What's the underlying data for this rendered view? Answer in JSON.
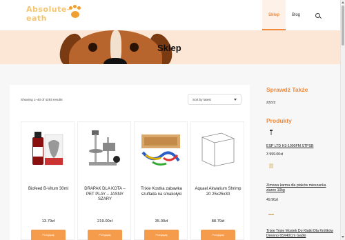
{
  "header": {
    "logo_text": "Absolute-eath",
    "nav": [
      {
        "label": "Sklep",
        "active": true
      },
      {
        "label": "Blog",
        "active": false
      }
    ],
    "search_icon": "search-icon",
    "accent": "#f08a3c"
  },
  "banner": {
    "title": "Sklep",
    "background": "#fce7d6"
  },
  "shop": {
    "results_text": "Showing 1–40 of 4293 results",
    "sort_label": "Sort by latest",
    "products": [
      {
        "name": "Biofeed B-Vitum 30ml",
        "price": "13.79zł",
        "button": "Przeglądaj"
      },
      {
        "name": "DRAPAK DLA KOTA – PET PLAY – JASNY SZARY",
        "price": "219.00zł",
        "button": "Przeglądaj"
      },
      {
        "name": "Trixie Kostka zabawka szuflada na smakołyki",
        "price": "35.00zł",
        "button": "Przeglądaj"
      },
      {
        "name": "Aquael Akwarium Shrimp 20 25x25x30",
        "price": "88.79zł",
        "button": "Przeglądaj"
      }
    ],
    "button_color": "#f49c4b"
  },
  "sidebar": {
    "section1_title": "Sprawdź Także",
    "section1_text": "zzzzz",
    "section2_title": "Produkty",
    "products": [
      {
        "name": "ESP LTD H3-1000FM STPSB",
        "price": "3 999.00zł"
      },
      {
        "name": "Zimowa karma dla ptaków mieszanka ziaren 10kg",
        "price": "49.90zł"
      },
      {
        "name": "Trixie Trixie Mostek Do Klatki Dla Królików Drewno 65X40Cm Gadki",
        "price": ""
      }
    ]
  }
}
